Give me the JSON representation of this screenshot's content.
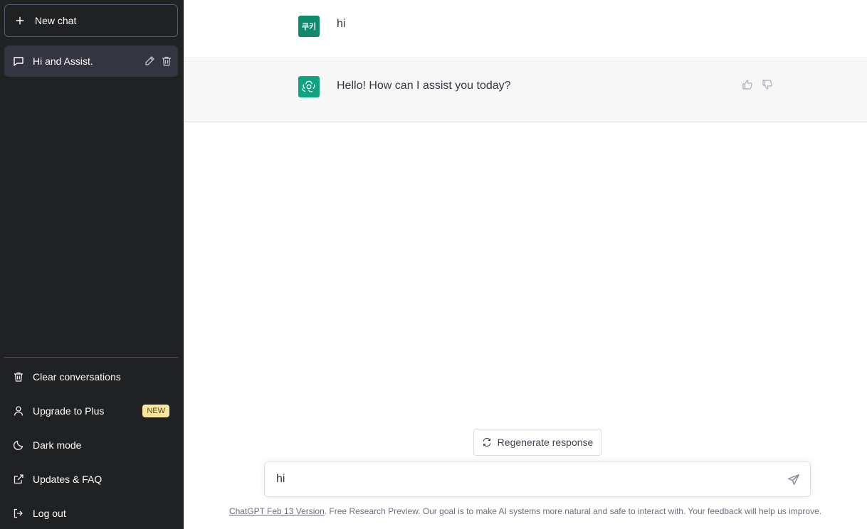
{
  "sidebar": {
    "new_chat_label": "New chat",
    "chats": [
      {
        "label": "Hi and Assist."
      }
    ],
    "menu": {
      "clear": "Clear conversations",
      "upgrade": "Upgrade to Plus",
      "upgrade_badge": "NEW",
      "dark_mode": "Dark mode",
      "updates": "Updates & FAQ",
      "logout": "Log out"
    }
  },
  "conversation": {
    "user": {
      "avatar_text": "쿠키",
      "message": "hi"
    },
    "assistant": {
      "message": "Hello! How can I assist you today?"
    }
  },
  "regenerate_label": "Regenerate response",
  "input": {
    "value": "hi"
  },
  "footer": {
    "link_text": "ChatGPT Feb 13 Version",
    "text": ". Free Research Preview. Our goal is to make AI systems more natural and safe to interact with. Your feedback will help us improve."
  },
  "colors": {
    "sidebar_bg": "#202123",
    "assistant_avatar": "#10a37f",
    "user_avatar": "#0f8a6d",
    "badge_bg": "#fae69e"
  },
  "icons": [
    "plus-icon",
    "chat-bubble-icon",
    "pencil-icon",
    "trash-icon",
    "user-icon",
    "moon-icon",
    "external-link-icon",
    "logout-icon",
    "openai-logo-icon",
    "thumbs-up-icon",
    "thumbs-down-icon",
    "refresh-icon",
    "send-icon"
  ]
}
